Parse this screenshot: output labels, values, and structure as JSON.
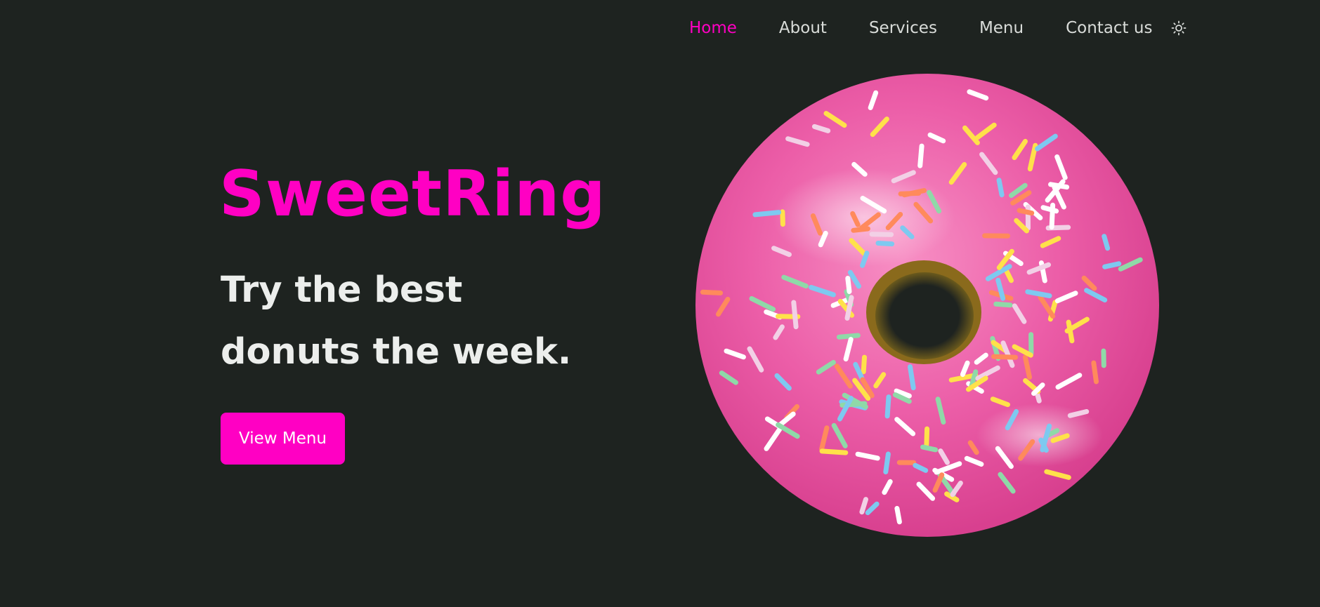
{
  "nav": {
    "links": [
      {
        "label": "Home",
        "active": true
      },
      {
        "label": "About",
        "active": false
      },
      {
        "label": "Services",
        "active": false
      },
      {
        "label": "Menu",
        "active": false
      },
      {
        "label": "Contact us",
        "active": false
      }
    ],
    "theme_toggle_icon": "sun-icon"
  },
  "hero": {
    "brand": "SweetRing",
    "tagline": "Try the best donuts the week.",
    "cta_label": "View Menu",
    "image_icon": "pink-donut-illustration"
  },
  "colors": {
    "background": "#1e2320",
    "accent": "#ff00c3",
    "nav_text": "#d9dcd9",
    "heading_text": "#eceeec"
  }
}
